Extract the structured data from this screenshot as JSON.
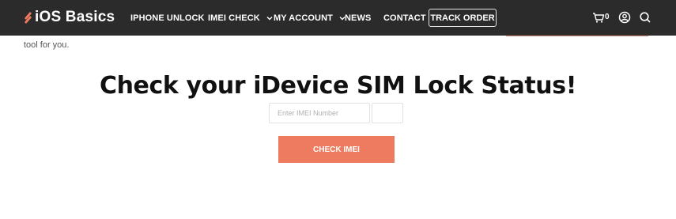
{
  "brand": {
    "name": "iOS Basics",
    "accent": "#ee7b5f"
  },
  "nav": {
    "items": [
      {
        "label": "IPHONE UNLOCK"
      },
      {
        "label": "IMEI CHECK"
      },
      {
        "label": "MY ACCOUNT"
      },
      {
        "label": "NEWS"
      },
      {
        "label": "CONTACT"
      }
    ],
    "track_order": "TRACK ORDER",
    "cart_count": "0",
    "icons": [
      "cart-icon",
      "account-icon",
      "search-icon"
    ]
  },
  "page": {
    "partial_text": "tool for you.",
    "heading": "Check your iDevice SIM Lock Status!",
    "imei_placeholder": "Enter IMEI Number",
    "check_button": "CHECK IMEI"
  },
  "colors": {
    "navbar": "#2b2b2b",
    "button": "#ee7b5f"
  }
}
